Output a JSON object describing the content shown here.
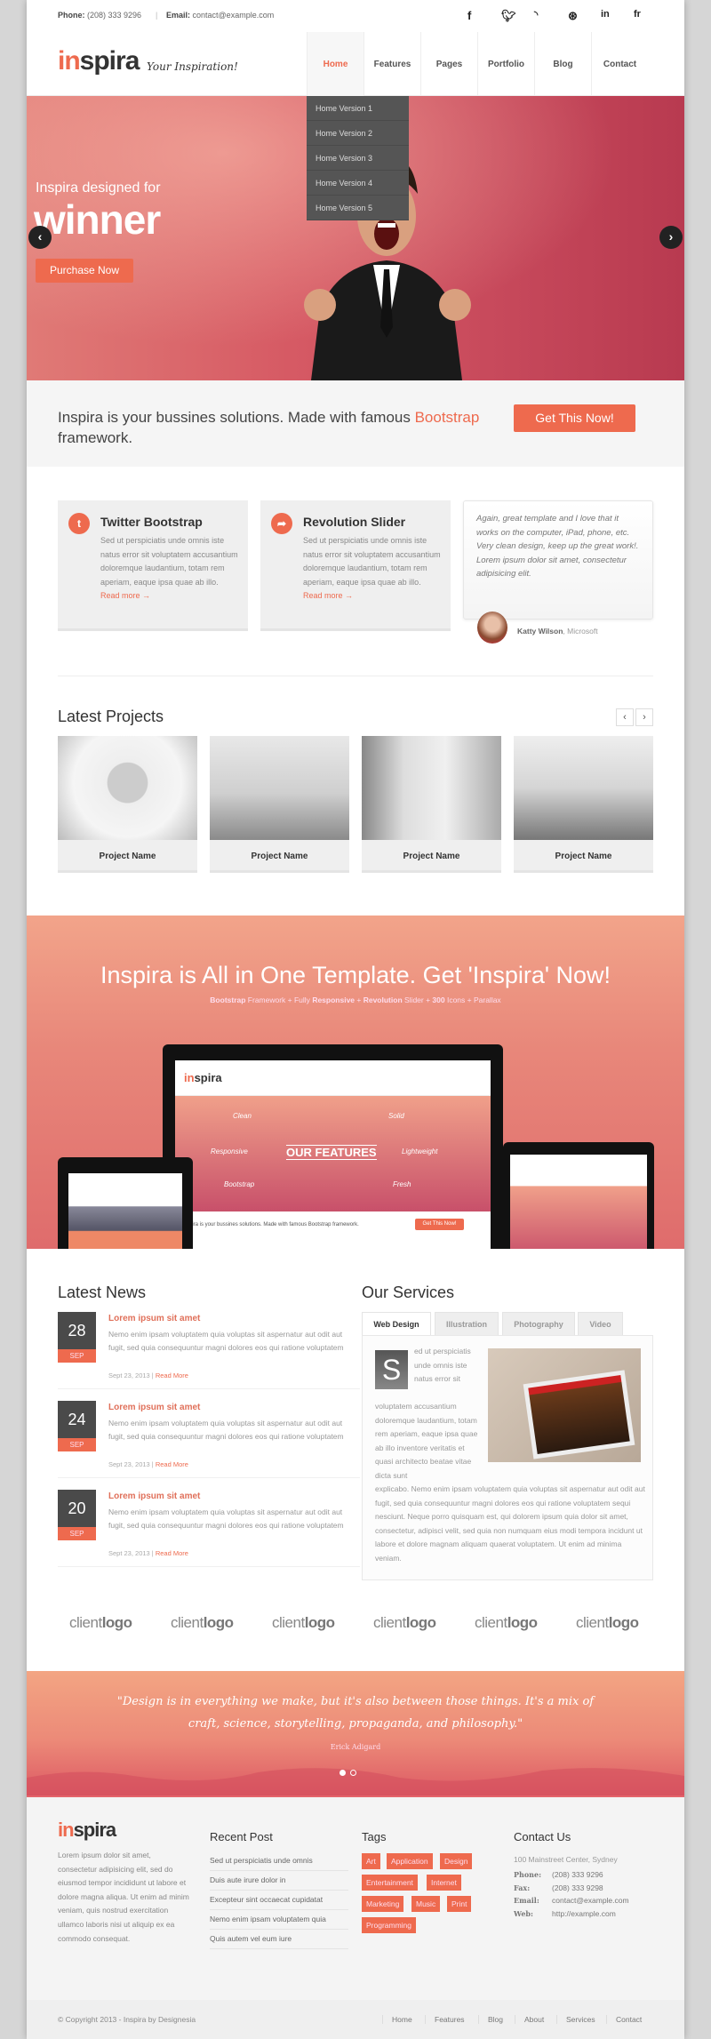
{
  "topbar": {
    "phone_label": "Phone:",
    "phone": "(208) 333 9296",
    "email_label": "Email:",
    "email": "contact@example.com",
    "social": [
      "f",
      "t",
      "rss",
      "dribbble",
      "in",
      "fr"
    ]
  },
  "header": {
    "logo_in": "in",
    "logo_rest": "spira",
    "tagline": "Your Inspiration!",
    "nav": [
      "Home",
      "Features",
      "Pages",
      "Portfolio",
      "Blog",
      "Contact"
    ],
    "dropdown": [
      "Home Version 1",
      "Home Version 2",
      "Home Version 3",
      "Home Version 4",
      "Home Version 5"
    ]
  },
  "hero": {
    "subtitle": "Inspira designed for",
    "title": "winner",
    "button": "Purchase Now",
    "prev": "‹",
    "next": "›"
  },
  "promo": {
    "text": "Inspira is your bussines solutions. Made with famous ",
    "link": "Bootstrap",
    "text_end": " framework.",
    "button": "Get This Now!"
  },
  "features": [
    {
      "title": "Twitter Bootstrap",
      "text": "Sed ut perspiciatis unde omnis iste natus error sit voluptatem accusantium doloremque laudantium, totam rem aperiam, eaque ipsa quae ab illo. ",
      "link": "Read more →",
      "icon": "twitter-icon"
    },
    {
      "title": "Revolution Slider",
      "text": "Sed ut perspiciatis unde omnis iste natus error sit voluptatem accusantium doloremque laudantium, totam rem aperiam, eaque ipsa quae ab illo. ",
      "link": "Read more →",
      "icon": "share-icon"
    }
  ],
  "testimonial": {
    "text": "Again, great template and I love that it works on the computer, iPad, phone, etc. Very clean design, keep up the great work!. Lorem ipsum dolor sit amet, consectetur adipisicing elit.",
    "name": "Katty Wilson",
    "company": ", Microsoft"
  },
  "projects": {
    "title": "Latest Projects",
    "prev": "‹",
    "next": "›",
    "items": [
      "Project Name",
      "Project Name",
      "Project Name",
      "Project Name"
    ]
  },
  "parallax": {
    "title": "Inspira is All in One Template. Get 'Inspira' Now!",
    "subtitle_parts": [
      "Bootstrap",
      " Framework + Fully ",
      "Responsive",
      " + ",
      "Revolution",
      " Slider + ",
      "300",
      " Icons + Parallax"
    ],
    "screen": {
      "features": "OUR FEATURES",
      "words": [
        "Clean",
        "Solid",
        "Responsive",
        "Lightweight",
        "Bootstrap",
        "Fresh"
      ],
      "promo": "Inspira is your bussines solutions. Made with famous Bootstrap framework.",
      "button": "Get This Now!"
    }
  },
  "news": {
    "title": "Latest News",
    "items": [
      {
        "day": "28",
        "month": "SEP",
        "title": "Lorem ipsum sit amet",
        "text": "Nemo enim ipsam voluptatem quia voluptas sit aspernatur aut odit aut fugit, sed quia consequuntur magni dolores eos qui ratione voluptatem",
        "date": "Sept 23, 2013 | ",
        "link": "Read More"
      },
      {
        "day": "24",
        "month": "SEP",
        "title": "Lorem ipsum sit amet",
        "text": "Nemo enim ipsam voluptatem quia voluptas sit aspernatur aut odit aut fugit, sed quia consequuntur magni dolores eos qui ratione voluptatem",
        "date": "Sept 23, 2013 | ",
        "link": "Read More"
      },
      {
        "day": "20",
        "month": "SEP",
        "title": "Lorem ipsum sit amet",
        "text": "Nemo enim ipsam voluptatem quia voluptas sit aspernatur aut odit aut fugit, sed quia consequuntur magni dolores eos qui ratione voluptatem",
        "date": "Sept 23, 2013 | ",
        "link": "Read More"
      }
    ]
  },
  "services": {
    "title": "Our Services",
    "tabs": [
      "Web Design",
      "Illustration",
      "Photography",
      "Video"
    ],
    "dropcap": "S",
    "text_top": "ed ut perspiciatis unde omnis iste natus error sit",
    "text_mid": "voluptatem accusantium doloremque laudantium, totam rem aperiam, eaque ipsa quae ab illo inventore veritatis et quasi architecto beatae vitae dicta sunt",
    "text_bottom": "explicabo. Nemo enim ipsam voluptatem quia voluptas sit aspernatur aut odit aut fugit, sed quia consequuntur magni dolores eos qui ratione voluptatem sequi nesciunt. Neque porro quisquam est, qui dolorem ipsum quia dolor sit amet, consectetur, adipisci velit, sed quia non numquam eius modi tempora incidunt ut labore et dolore magnam aliquam quaerat voluptatem. Ut enim ad minima veniam."
  },
  "clients": {
    "light": "client",
    "bold": "logo",
    "count": 6
  },
  "quote": {
    "text": "\"Design is in everything we make, but it's also between those things. It's a mix of craft, science, storytelling, propaganda, and philosophy.\"",
    "author": "Erick Adigard"
  },
  "footer": {
    "about": "Lorem ipsum dolor sit amet, consectetur adipisicing elit, sed do eiusmod tempor incididunt ut labore et dolore magna aliqua. Ut enim ad minim veniam, quis nostrud exercitation ullamco laboris nisi ut aliquip ex ea commodo consequat.",
    "recent_title": "Recent Post",
    "recent": [
      "Sed ut perspiciatis unde omnis",
      "Duis aute irure dolor in",
      "Excepteur sint occaecat cupidatat",
      "Nemo enim ipsam voluptatem quia",
      "Quis autem vel eum iure"
    ],
    "tags_title": "Tags",
    "tags": [
      "Art",
      "Application",
      "Design",
      "Entertainment",
      "Internet",
      "Marketing",
      "Music",
      "Print",
      "Programming"
    ],
    "contact_title": "Contact Us",
    "address": "100 Mainstreet Center, Sydney",
    "contact": [
      {
        "label": "Phone:",
        "value": "(208) 333 9296"
      },
      {
        "label": "Fax:",
        "value": "(208) 333 9298"
      },
      {
        "label": "Email:",
        "value": "contact@example.com"
      },
      {
        "label": "Web:",
        "value": "http://example.com"
      }
    ],
    "copyright": "© Copyright 2013 - Inspira by Designesia",
    "nav": [
      "Home",
      "Features",
      "Blog",
      "About",
      "Services",
      "Contact"
    ]
  },
  "colors": {
    "accent": "#ee6a4e",
    "dark": "#4a4a4a"
  }
}
